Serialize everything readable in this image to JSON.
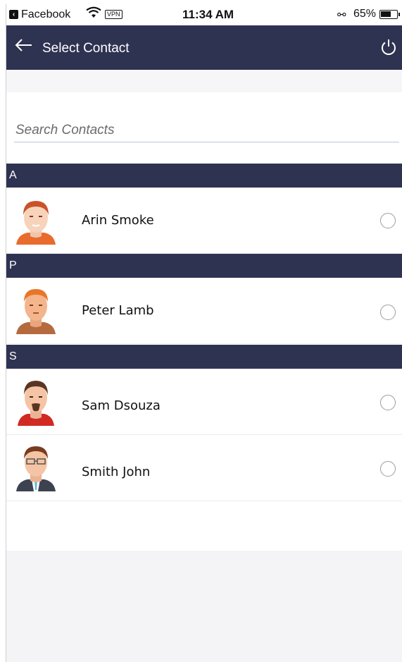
{
  "status_bar": {
    "app_name": "Facebook",
    "vpn_label": "VPN",
    "time": "11:34 AM",
    "battery_percent": "65%",
    "battery_level": 0.65
  },
  "header": {
    "title": "Select Contact",
    "back_icon": "arrow-left-icon",
    "power_icon": "power-icon"
  },
  "search": {
    "placeholder": "Search Contacts",
    "value": ""
  },
  "sections": [
    {
      "letter": "A",
      "contacts": [
        {
          "name": "Arin Smoke",
          "selected": false
        }
      ]
    },
    {
      "letter": "P",
      "contacts": [
        {
          "name": "Peter Lamb",
          "selected": false
        }
      ]
    },
    {
      "letter": "S",
      "contacts": [
        {
          "name": "Sam Dsouza",
          "selected": false
        },
        {
          "name": "Smith John",
          "selected": false
        }
      ]
    }
  ],
  "colors": {
    "header_bg": "#2f3352",
    "section_bg": "#2f3352",
    "radio_border": "#9c9c9c"
  }
}
